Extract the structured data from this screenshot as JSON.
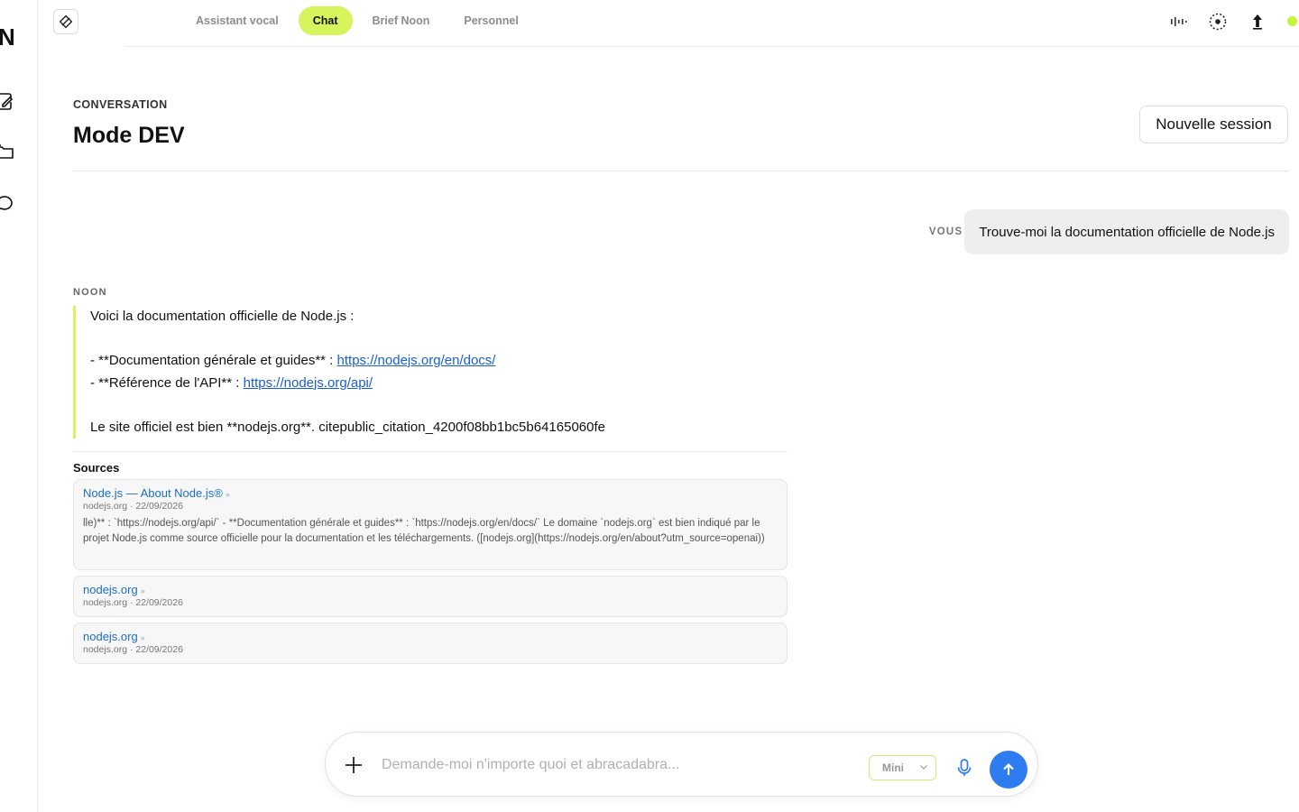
{
  "rail": {
    "logo": "N"
  },
  "nav": {
    "tabs": [
      {
        "label": "Assistant vocal",
        "active": false
      },
      {
        "label": "Chat",
        "active": true
      },
      {
        "label": "Brief Noon",
        "active": false
      },
      {
        "label": "Personnel",
        "active": false
      }
    ]
  },
  "header": {
    "section_label": "CONVERSATION",
    "title": "Mode DEV",
    "new_session_label": "Nouvelle session"
  },
  "messages": {
    "user_tag": "VOUS",
    "user_text": "Trouve-moi la documentation officielle de Node.js",
    "assistant_tag": "NOON",
    "assistant": {
      "intro": "Voici la documentation officielle de Node.js :",
      "line1_prefix": "- **Documentation générale et guides** : ",
      "line1_link": "https://nodejs.org/en/docs/",
      "line2_prefix": "- **Référence de l'API** : ",
      "line2_link": "https://nodejs.org/api/",
      "closing": "Le site officiel est bien **nodejs.org**. citepublic_citation_4200f08bb1bc5b64165060fe"
    }
  },
  "sources": {
    "title": "Sources",
    "items": [
      {
        "title": "Node.js — About Node.js®",
        "meta": "nodejs.org · 22/09/2026",
        "excerpt": "lle)** : `https://nodejs.org/api/` - **Documentation générale et guides** : `https://nodejs.org/en/docs/` Le domaine `nodejs.org` est bien indiqué par le projet Node.js comme source officielle pour la documentation et les téléchargements. ([nodejs.org](https://nodejs.org/en/about?utm_source=openai))"
      },
      {
        "title": "nodejs.org",
        "meta": "nodejs.org · 22/09/2026"
      },
      {
        "title": "nodejs.org",
        "meta": "nodejs.org · 22/09/2026"
      }
    ],
    "arrow": "»"
  },
  "composer": {
    "placeholder": "Demande-moi n'importe quoi et abracadabra...",
    "model": "Mini"
  },
  "colors": {
    "accent": "#d6f45c",
    "link": "#1a5fd6",
    "send": "#2d7cf0",
    "status": "#c9f23a"
  }
}
